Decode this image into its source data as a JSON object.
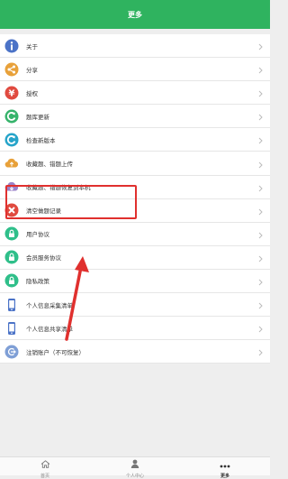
{
  "header": {
    "title": "更多"
  },
  "menu": [
    {
      "label": "关于",
      "icon": "info-icon",
      "color": "#4b73c7"
    },
    {
      "label": "分享",
      "icon": "share-icon",
      "color": "#e8a13a"
    },
    {
      "label": "授权",
      "icon": "yen-icon",
      "color": "#e04a3f"
    },
    {
      "label": "题库更新",
      "icon": "refresh-icon",
      "color": "#36b36b"
    },
    {
      "label": "检查新版本",
      "icon": "update-icon",
      "color": "#26a4c9"
    },
    {
      "label": "收藏题、错题上传",
      "icon": "cloud-upload-icon",
      "color": "#e8a13a"
    },
    {
      "label": "收藏题、错题恢复到本机",
      "icon": "cloud-download-icon",
      "color": "#9b83c9"
    },
    {
      "label": "清空做题记录",
      "icon": "close-icon",
      "color": "#e04a3f"
    },
    {
      "label": "用户协议",
      "icon": "lock-icon",
      "color": "#2fbf8a"
    },
    {
      "label": "会员服务协议",
      "icon": "lock-icon",
      "color": "#2fbf8a"
    },
    {
      "label": "隐私政策",
      "icon": "lock-icon",
      "color": "#2fbf8a"
    },
    {
      "label": "个人信息采集清单",
      "icon": "phone-icon",
      "color": "#4b73c7"
    },
    {
      "label": "个人信息共享清单",
      "icon": "phone-icon",
      "color": "#4b73c7"
    },
    {
      "label": "注销账户（不可恢复）",
      "icon": "logout-icon",
      "color": "#7f9fd6"
    }
  ],
  "tabbar": [
    {
      "label": "首页",
      "icon": "home-icon"
    },
    {
      "label": "个人中心",
      "icon": "user-icon"
    },
    {
      "label": "更多",
      "icon": "more-icon"
    }
  ],
  "colors": {
    "header": "#2fb35f",
    "highlight": "#e0302e"
  }
}
